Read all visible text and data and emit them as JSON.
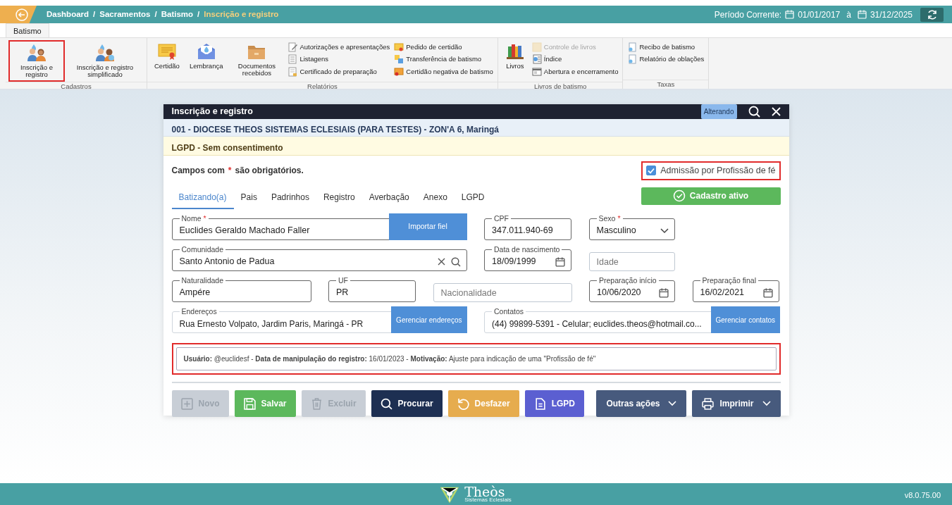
{
  "topbar": {
    "breadcrumb": [
      {
        "label": "Dashboard",
        "current": false
      },
      {
        "label": "Sacramentos",
        "current": false
      },
      {
        "label": "Batismo",
        "current": false
      },
      {
        "label": "Inscrição e registro",
        "current": true
      }
    ],
    "separators": [
      "/",
      "/",
      "/"
    ],
    "period_label": "Período Corrente:",
    "period_start": "01/01/2017",
    "period_joiner": "à",
    "period_end": "31/12/2025"
  },
  "ribbon": {
    "tabs": [
      {
        "label": "Batismo",
        "selected": true
      }
    ],
    "groups": [
      {
        "title": "Cadastros",
        "items": [
          {
            "kind": "large",
            "label": "Inscrição e registro",
            "highlighted": true
          },
          {
            "kind": "large",
            "label": "Inscrição e registro simplificado",
            "highlighted": false
          }
        ]
      },
      {
        "title": "Relatórios",
        "items": [
          {
            "kind": "large",
            "label": "Certidão",
            "highlighted": false
          },
          {
            "kind": "large",
            "label": "Lembrança",
            "highlighted": false
          },
          {
            "kind": "large",
            "label": "Documentos recebidos",
            "highlighted": false
          },
          {
            "kind": "column",
            "entries": [
              {
                "label": "Autorizações e apresentações",
                "disabled": false
              },
              {
                "label": "Listagens",
                "disabled": false
              },
              {
                "label": "Certificado de preparação",
                "disabled": false
              }
            ]
          },
          {
            "kind": "column",
            "entries": [
              {
                "label": "Pedido de certidão",
                "disabled": false
              },
              {
                "label": "Transferência de batismo",
                "disabled": false
              },
              {
                "label": "Certidão negativa de batismo",
                "disabled": false
              }
            ]
          }
        ]
      },
      {
        "title": "Livros de batismo",
        "items": [
          {
            "kind": "large",
            "label": "Livros",
            "highlighted": false
          },
          {
            "kind": "column",
            "entries": [
              {
                "label": "Controle de livros",
                "disabled": true
              },
              {
                "label": "Índice",
                "disabled": false
              },
              {
                "label": "Abertura e encerramento",
                "disabled": false
              }
            ]
          }
        ]
      },
      {
        "title": "Taxas",
        "items": [
          {
            "kind": "column",
            "entries": [
              {
                "label": "Recibo de batismo",
                "disabled": false
              },
              {
                "label": "Relatório de oblações",
                "disabled": false
              }
            ]
          }
        ]
      }
    ]
  },
  "modal": {
    "title": "Inscrição e registro",
    "status_badge": "Alterando",
    "organization": "001 - DIOCESE THEOS SISTEMAS ECLESIAIS (PARA TESTES) - ZON'A 6, Maringá",
    "lgpd_notice": "LGPD - Sem consentimento",
    "required_note": {
      "before": "Campos com",
      "mark": "*",
      "after": "são obrigatórios."
    },
    "admission_checkbox": {
      "label": "Admissão por Profissão de fé",
      "checked": true,
      "highlighted": true
    },
    "tabs": [
      {
        "label": "Batizando(a)",
        "selected": true
      },
      {
        "label": "Pais",
        "selected": false
      },
      {
        "label": "Padrinhos",
        "selected": false
      },
      {
        "label": "Registro",
        "selected": false
      },
      {
        "label": "Averbação",
        "selected": false
      },
      {
        "label": "Anexo",
        "selected": false
      },
      {
        "label": "LGPD",
        "selected": false
      }
    ],
    "status_button": "Cadastro ativo",
    "form_rows": [
      [
        {
          "kind": "text",
          "label": "Nome",
          "required": true,
          "value": "Euclides Geraldo Machado Faller",
          "button": "Importar fiel"
        },
        {
          "kind": "text",
          "label": "CPF",
          "required": false,
          "value": "347.011.940-69"
        },
        {
          "kind": "select",
          "label": "Sexo",
          "required": true,
          "value": "Masculino"
        }
      ],
      [
        {
          "kind": "search",
          "label": "Comunidade",
          "required": false,
          "value": "Santo Antonio de Padua"
        },
        {
          "kind": "date",
          "label": "Data de nascimento",
          "required": false,
          "value": "18/09/1999"
        },
        {
          "kind": "empty",
          "placeholder": "Idade"
        }
      ],
      [
        {
          "kind": "text",
          "label": "Naturalidade",
          "required": false,
          "value": "Ampére"
        },
        {
          "kind": "text",
          "label": "UF",
          "required": false,
          "value": "PR"
        },
        {
          "kind": "empty",
          "placeholder": "Nacionalidade"
        },
        {
          "kind": "date",
          "label": "Preparação início",
          "required": false,
          "value": "10/06/2020"
        },
        {
          "kind": "date",
          "label": "Preparação final",
          "required": false,
          "value": "16/02/2021"
        }
      ],
      [
        {
          "kind": "managed",
          "label": "Endereços",
          "required": false,
          "value": "Rua Ernesto Volpato, Jardim Paris, Maringá - PR",
          "button": "Gerenciar endereços"
        },
        {
          "kind": "managed",
          "label": "Contatos",
          "required": false,
          "value": "(44) 99899-5391 - Celular; euclides.theos@hotmail.co...",
          "button": "Gerenciar contatos"
        }
      ]
    ],
    "audit_log": {
      "text": "**Usuário:** @euclidesf - **Data de manipulação do registro:** 16/01/2023 - **Motivação:** Ajuste para indicação de uma \"Profissão de fé\"",
      "highlighted": true
    },
    "actions": {
      "main": [
        {
          "kind": "new",
          "label": "Novo",
          "disabled": true,
          "dropdown": false
        },
        {
          "kind": "save",
          "label": "Salvar",
          "disabled": false,
          "dropdown": false
        },
        {
          "kind": "delete",
          "label": "Excluir",
          "disabled": true,
          "dropdown": false
        },
        {
          "kind": "search",
          "label": "Procurar",
          "disabled": false,
          "dropdown": false
        },
        {
          "kind": "undo",
          "label": "Desfazer",
          "disabled": false,
          "dropdown": false
        },
        {
          "kind": "lgpd",
          "label": "LGPD",
          "disabled": false,
          "dropdown": false
        }
      ],
      "secondary": [
        {
          "kind": "more",
          "label": "Outras ações",
          "disabled": false,
          "dropdown": true
        },
        {
          "kind": "print",
          "label": "Imprimir",
          "disabled": false,
          "dropdown": true
        }
      ]
    }
  },
  "footer": {
    "logo_text": "Theòs",
    "logo_tagline": "Sistemas Eclesiais",
    "version": "v8.0.75.00"
  }
}
